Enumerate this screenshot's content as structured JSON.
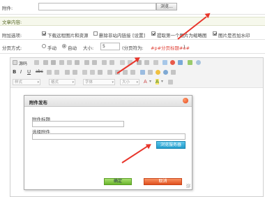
{
  "attachment": {
    "label": "附件:",
    "browse_label": "浏览..."
  },
  "section": {
    "title": "文章内容:"
  },
  "options": {
    "label": "附加选项:",
    "items": [
      {
        "text": "下载远程图片和资源",
        "checked": true
      },
      {
        "text": "删除非站内链接",
        "checked": false
      },
      {
        "text": "[设置]",
        "checked": null
      },
      {
        "text": "提取第一个图片为缩略图",
        "checked": true
      },
      {
        "text": "图片是否加水印",
        "checked": true
      }
    ]
  },
  "paging": {
    "label": "分页方式:",
    "manual": "手动",
    "auto": "自动",
    "size_label": "大小:",
    "size_value": "5",
    "hint": "(分页符为:",
    "hint_tag": "#p#分页标题#e#",
    "hint_end": ")"
  },
  "editor": {
    "source_label": "源码",
    "combos": [
      "样式",
      "格式",
      "字体",
      "大小"
    ]
  },
  "dialog": {
    "title": "附件发布",
    "title_field_label": "附件标题",
    "title_field_value": "",
    "file_field_label": "选择附件",
    "file_field_value": "",
    "browse_server": "浏览服务器",
    "ok": "确定",
    "cancel": "取消"
  },
  "colors": {
    "annotation_arrow": "#e8352b",
    "ok_button": "#7cc23c",
    "cancel_button": "#e85e2c",
    "browse_server": "#2da9d6"
  }
}
